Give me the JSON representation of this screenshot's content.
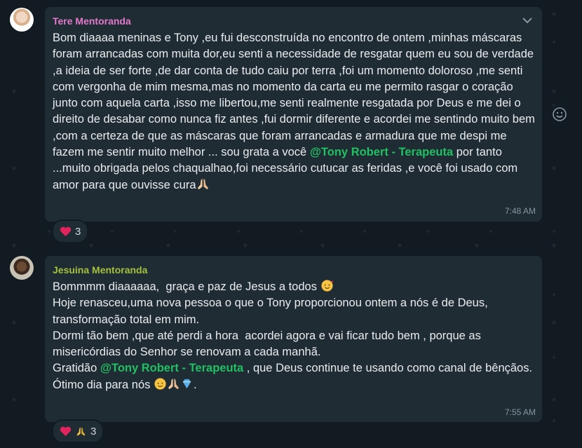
{
  "messages": [
    {
      "sender": "Tere Mentoranda",
      "text_before": "Bom diaaaa meninas e Tony ,eu fui desconstruída no encontro de ontem ,minhas máscaras foram arrancadas com muita dor,eu senti a necessidade de resgatar quem eu sou de verdade ,a ideia de ser forte ,de dar conta de tudo caiu por terra ,foi um momento doloroso ,me senti com vergonha de mim mesma,mas no momento da carta eu me permito rasgar o coração junto com aquela carta ,isso me libertou,me senti realmente resgatada por Deus e me dei o direito de desabar como nunca fiz antes ,fui dormir diferente e acordei me sentindo muito bem ,com a certeza de que as máscaras que foram arrancadas e armadura que me despi me fazem me sentir muito melhor ... sou grata a você ",
      "mention": "@Tony Robert - Terapeuta",
      "text_after": " por tanto ...muito obrigada pelos chaqualhao,foi necessário cutucar as feridas ,e você foi usado com amor para que ouvisse cura",
      "time": "7:48 AM",
      "reaction_count": "3",
      "reaction_icons": [
        "heart-icon"
      ]
    },
    {
      "sender": "Jesuina Mentoranda",
      "line1": "Bommmm diaaaaaa,  graça e paz de Jesus a todos ",
      "line2": "Hoje renasceu,uma nova pessoa o que o Tony proporcionou ontem a nós é de Deus, transformação total em mim.",
      "line3": "Dormi tão bem ,que até perdi a hora  acordei agora e vai ficar tudo bem , porque as misericórdias do Senhor se renovam a cada manhã.",
      "line4_before": "Gratidão ",
      "mention": "@Tony Robert - Terapeuta",
      "line4_after": " , que Deus continue te usando como canal de bênçãos.",
      "line5": "Ótimo dia para nós ",
      "line5_end": ".",
      "time": "7:55 AM",
      "reaction_count": "3",
      "reaction_icons": [
        "heart-icon",
        "praying-hands-icon"
      ]
    }
  ],
  "colors": {
    "background": "#111b21",
    "bubble": "#202c33",
    "sender1": "#e27acb",
    "sender2": "#a2c03e",
    "mention": "#21c063",
    "meta": "#8696a0"
  }
}
